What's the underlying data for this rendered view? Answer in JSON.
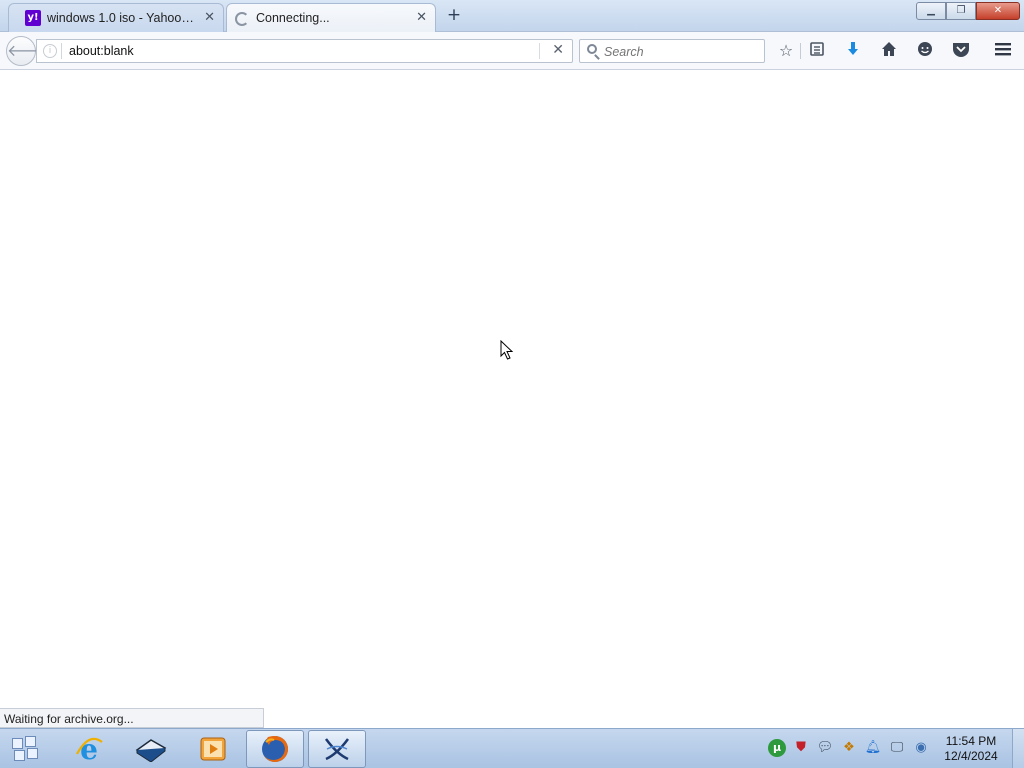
{
  "tabs": [
    {
      "label": "windows 1.0 iso - Yahoo Se...",
      "favicon": "yahoo-icon",
      "active": false
    },
    {
      "label": "Connecting...",
      "favicon": "loading-spinner-icon",
      "active": true
    }
  ],
  "toolbar": {
    "new_tab_symbol": "+",
    "url": "about:blank",
    "search_placeholder": "Search"
  },
  "window_controls": {
    "minimize": "▁",
    "restore": "❐",
    "close": "✕"
  },
  "status_text": "Waiting for archive.org...",
  "taskbar": {
    "time": "11:54 PM",
    "date": "12/4/2024",
    "pinned": [
      "internet-explorer-icon",
      "book-icon",
      "media-player-icon",
      "firefox-icon",
      "app-x-icon"
    ]
  },
  "colors": {
    "yahoo_purple": "#6001d2",
    "download_blue": "#1a8be0",
    "taskbar": "#b8cde8"
  }
}
